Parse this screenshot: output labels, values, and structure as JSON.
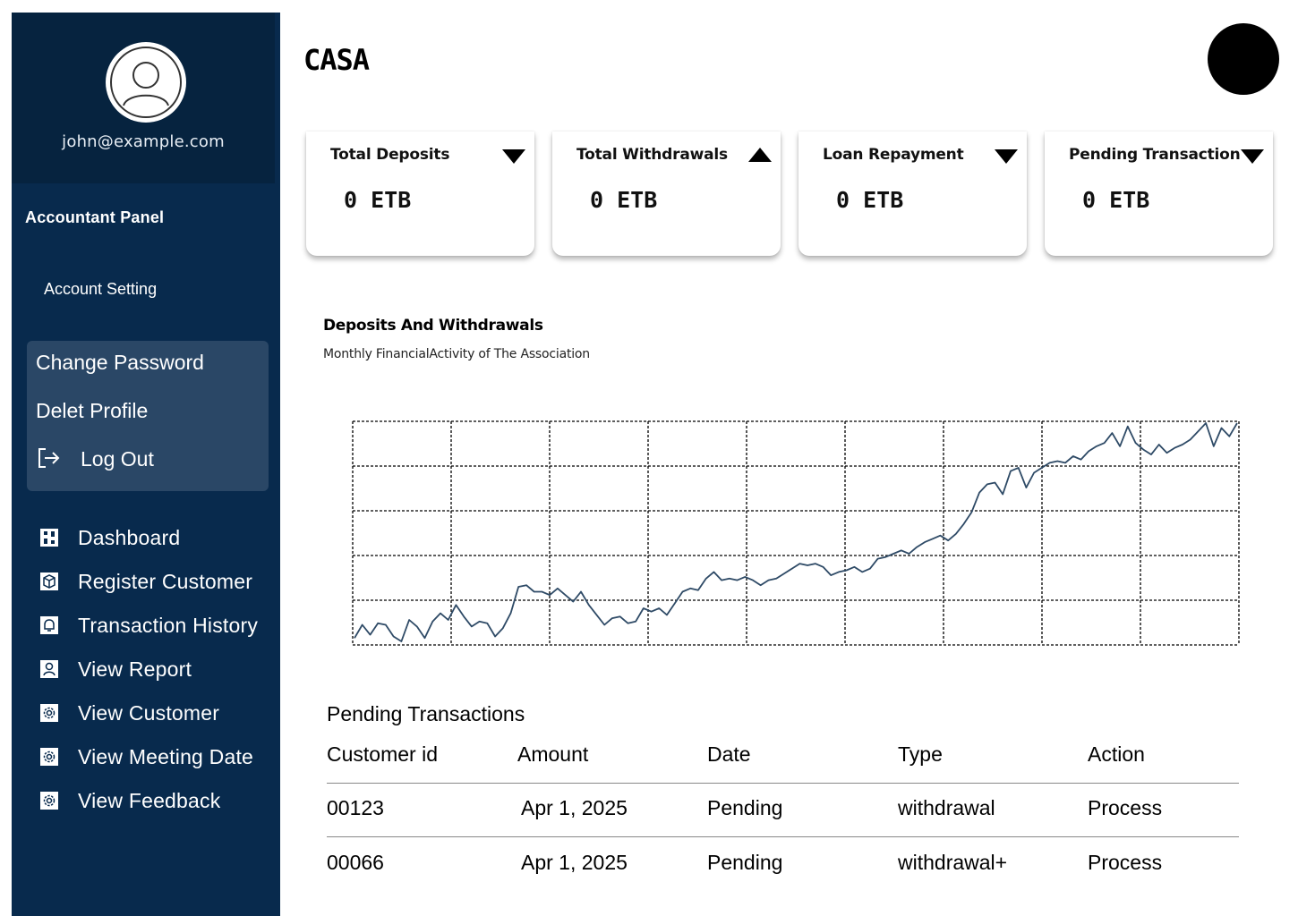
{
  "app": {
    "title": "CASA"
  },
  "sidebar": {
    "email": "john@example.com",
    "panel_title": "Accountant Panel",
    "account_setting": "Account Setting",
    "settings_items": [
      "Change Password",
      "Delet Profile",
      "Log Out"
    ],
    "nav": [
      {
        "label": "Dashboard",
        "icon": "dashboard-icon"
      },
      {
        "label": "Register Customer",
        "icon": "package-icon"
      },
      {
        "label": "Transaction History",
        "icon": "bell-icon"
      },
      {
        "label": "View Report",
        "icon": "user-icon"
      },
      {
        "label": "View Customer",
        "icon": "gear-icon"
      },
      {
        "label": "View Meeting Date",
        "icon": "gear-icon"
      },
      {
        "label": "View Feedback",
        "icon": "gear-icon"
      }
    ]
  },
  "cards": [
    {
      "label": "Total Deposits",
      "value": "0 ETB",
      "arrow": "down"
    },
    {
      "label": "Total Withdrawals",
      "value": "0 ETB",
      "arrow": "up"
    },
    {
      "label": "Loan Repayment",
      "value": "0 ETB",
      "arrow": "down"
    },
    {
      "label": "Pending Transaction",
      "value": "0 ETB",
      "arrow": "down"
    }
  ],
  "chart": {
    "title": "Deposits And Withdrawals",
    "subtitle": "Monthly FinancialActivity of The Association"
  },
  "chart_data": {
    "type": "line",
    "title": "Deposits And Withdrawals",
    "subtitle": "Monthly FinancialActivity of The Association",
    "xlabel": "",
    "ylabel": "",
    "grid": true,
    "legend": "none",
    "ylim": [
      0,
      100
    ],
    "series": [
      {
        "color": "#2e4a66",
        "values": [
          2,
          10,
          4,
          11,
          10,
          3,
          0,
          13,
          9,
          2,
          12,
          17,
          13,
          22,
          15,
          9,
          12,
          11,
          3,
          8,
          17,
          33,
          34,
          30,
          30,
          28,
          32,
          28,
          24,
          30,
          22,
          16,
          10,
          14,
          15,
          11,
          12,
          20,
          18,
          20,
          16,
          23,
          30,
          32,
          31,
          38,
          42,
          37,
          38,
          37,
          39,
          37,
          34,
          37,
          38,
          41,
          44,
          47,
          46,
          47,
          45,
          40,
          42,
          43,
          45,
          42,
          44,
          50,
          51,
          53,
          55,
          53,
          57,
          60,
          62,
          64,
          61,
          65,
          71,
          78,
          90,
          95,
          96,
          89,
          103,
          105,
          93,
          102,
          105,
          108,
          109,
          108,
          112,
          110,
          115,
          118,
          120,
          126,
          118,
          130,
          120,
          116,
          113,
          119,
          114,
          117,
          119,
          122,
          127,
          132,
          118,
          129,
          124,
          132
        ]
      }
    ],
    "y_range_note": "",
    "x_points": 114
  },
  "table": {
    "title": "Pending Transactions",
    "columns": [
      "Customer id",
      "Amount",
      "Date",
      "Type",
      "Action"
    ],
    "rows": [
      [
        "00123",
        "Apr 1, 2025",
        "Pending",
        "withdrawal",
        "Process"
      ],
      [
        "00066",
        "Apr 1, 2025",
        "Pending",
        "withdrawal+",
        "Process"
      ]
    ]
  },
  "colors": {
    "sidebar_bg": "#082a4d",
    "profile_bg": "#06233f",
    "settings_bg": "#2a4766",
    "chart_line": "#2e4a66"
  }
}
